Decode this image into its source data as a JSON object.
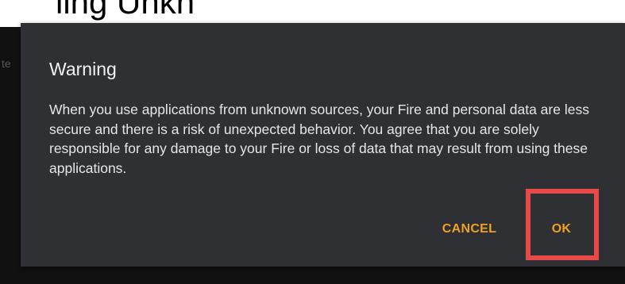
{
  "caption": {
    "text": "ling Unkn"
  },
  "background": {
    "partial_text": "te"
  },
  "dialog": {
    "title": "Warning",
    "message": "When you use applications from unknown sources, your Fire and personal data are less secure and there is a risk of unexpected behavior. You agree that you are solely responsible for any damage to your Fire or loss of data that may result from using these applications.",
    "buttons": {
      "cancel_label": "CANCEL",
      "ok_label": "OK"
    }
  },
  "colors": {
    "dialog_background": "#2f3033",
    "accent": "#f0a024",
    "highlight": "#e84a4a",
    "backdrop": "#111111"
  }
}
